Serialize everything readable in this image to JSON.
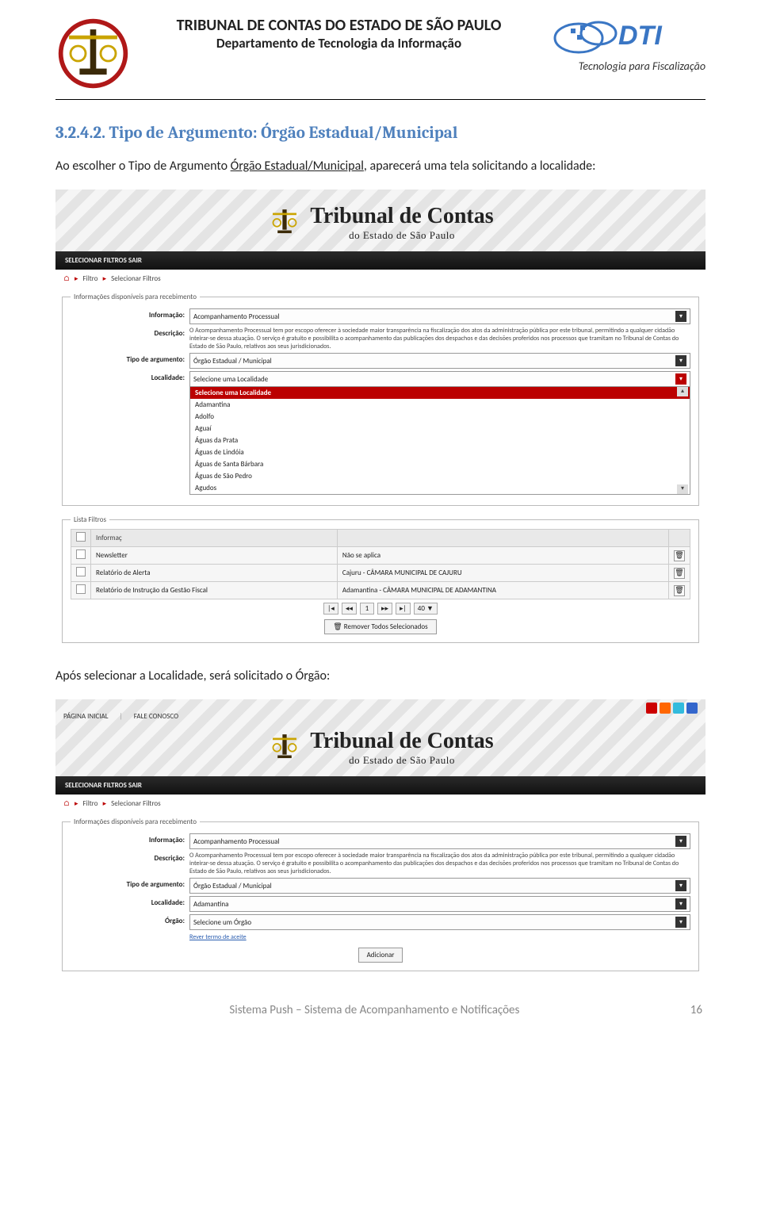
{
  "header": {
    "line1": "TRIBUNAL DE CONTAS DO ESTADO DE SÃO PAULO",
    "line2": "Departamento de Tecnologia da Informação",
    "dti_text": "DTI",
    "dti_sub": "Tecnologia para Fiscalização"
  },
  "section": {
    "heading": "3.2.4.2. Tipo de Argumento: Órgão Estadual/Municipal",
    "p1_before": "Ao escolher o Tipo de Argumento ",
    "p1_underline": "Órgão Estadual/Municipal",
    "p1_after": ", aparecerá uma tela solicitando a localidade:",
    "p2": "Após selecionar a Localidade, será solicitado o Órgão:"
  },
  "shot1": {
    "logo_big": "Tribunal de Contas",
    "logo_sub": "do Estado de São Paulo",
    "menu": "SELECIONAR FILTROS      SAIR",
    "crumb_filtro": "Filtro",
    "crumb_sel": "Selecionar Filtros",
    "nav_pagina": "PÁGINA INICIAL",
    "nav_fale": "FALE CONOSCO",
    "fieldset": "Informações disponíveis para recebimento",
    "lab_informacao": "Informação:",
    "val_informacao": "Acompanhamento Processual",
    "lab_descricao": "Descrição:",
    "val_descricao": "O Acompanhamento Processual tem por escopo oferecer à sociedade maior transparência na fiscalização dos atos da administração pública por este tribunal, permitindo a qualquer cidadão inteirar-se dessa atuação. O serviço é gratuito e possibilita o acompanhamento das publicações dos despachos e das decisões proferidos nos processos que tramitam no Tribunal de Contas do Estado de São Paulo, relativos aos seus jurisdicionados.",
    "lab_tipo": "Tipo de argumento:",
    "val_tipo": "Órgão Estadual / Municipal",
    "lab_local": "Localidade:",
    "val_local": "Selecione uma Localidade",
    "dropdown": [
      "Selecione uma Localidade",
      "Adamantina",
      "Adolfo",
      "Aguaí",
      "Águas da Prata",
      "Águas de Lindóia",
      "Águas de Santa Bárbara",
      "Águas de São Pedro",
      "Agudos"
    ],
    "fs_lista": "Lista Filtros",
    "th_info": "Informaç",
    "rows": [
      {
        "a": "Newsletter",
        "b": "Não se aplica"
      },
      {
        "a": "Relatório de Alerta",
        "b": "Cajuru - CÂMARA MUNICIPAL DE CAJURU"
      },
      {
        "a": "Relatório de Instrução da Gestão Fiscal",
        "b": "Adamantina - CÂMARA MUNICIPAL DE ADAMANTINA"
      }
    ],
    "pager": {
      "first": "|◂",
      "prev": "◂◂",
      "cur": "1",
      "next": "▸▸",
      "last": "▸|",
      "size": "40 ▼"
    },
    "remove_all": "Remover Todos Selecionados"
  },
  "shot2": {
    "lab_orgao": "Órgão:",
    "val_orgao": "Selecione um Órgão",
    "val_local": "Adamantina",
    "link_termo": "Rever termo de aceite",
    "btn_add": "Adicionar"
  },
  "footer": {
    "text": "Sistema Push – Sistema de Acompanhamento e Notificações",
    "pageno": "16"
  }
}
